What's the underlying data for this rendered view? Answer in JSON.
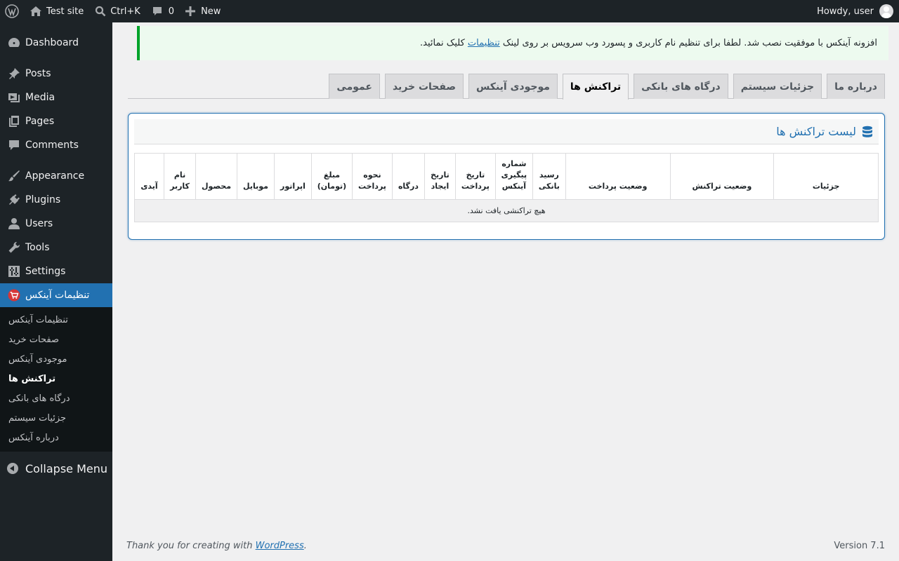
{
  "admin_bar": {
    "site_name": "Test site",
    "search_shortcut": "Ctrl+K",
    "comments_count": "0",
    "new_label": "New",
    "howdy": "Howdy, user"
  },
  "sidebar": {
    "items": [
      {
        "label": "Dashboard",
        "icon": "dashboard-icon"
      },
      {
        "label": "Posts",
        "icon": "pin-icon"
      },
      {
        "label": "Media",
        "icon": "media-icon"
      },
      {
        "label": "Pages",
        "icon": "pages-icon"
      },
      {
        "label": "Comments",
        "icon": "comment-icon"
      },
      {
        "label": "Appearance",
        "icon": "brush-icon"
      },
      {
        "label": "Plugins",
        "icon": "plugin-icon"
      },
      {
        "label": "Users",
        "icon": "user-icon"
      },
      {
        "label": "Tools",
        "icon": "wrench-icon"
      },
      {
        "label": "Settings",
        "icon": "sliders-icon"
      },
      {
        "label": "تنظیمات آینکس",
        "icon": "cart-icon"
      }
    ],
    "submenu": [
      "تنظیمات آینکس",
      "صفحات خرید",
      "موجودی آینکس",
      "تراکنش ها",
      "درگاه های بانکی",
      "جزئیات سیستم",
      "درباره آینکس"
    ],
    "collapse_label": "Collapse Menu"
  },
  "notice": {
    "text_before": "افزونه آینکس با موفقیت نصب شد. لطفا برای تنظیم نام کاربری و پسورد وب سرویس بر روی لینک",
    "link_text": "تنظیمات",
    "text_after": "کلیک نمائید."
  },
  "tabs": [
    "درباره ما",
    "جزئیات سیستم",
    "درگاه های بانکی",
    "تراکنش ها",
    "موجودی آینکس",
    "صفحات خرید",
    "عمومی"
  ],
  "panel": {
    "title": "لیست تراکنش ها",
    "columns": [
      "جزئیات",
      "وضعیت تراکنش",
      "وضعیت پرداخت",
      "رسید بانکی",
      "شماره پیگیری آینکس",
      "تاریخ پرداخت",
      "تاریخ ایجاد",
      "درگاه",
      "نحوه پرداخت",
      "مبلغ (تومان)",
      "اپراتور",
      "موبایل",
      "محصول",
      "نام کاربر",
      "آیدی"
    ],
    "empty_message": "هیچ تراکنشی یافت نشد."
  },
  "footer": {
    "thanks_prefix": "Thank you for creating with",
    "thanks_link": "WordPress",
    "thanks_suffix": ".",
    "version": "Version 7.1"
  },
  "colors": {
    "accent": "#2271b1",
    "admin_dark": "#1d2327",
    "notice_green": "#00a32a"
  }
}
